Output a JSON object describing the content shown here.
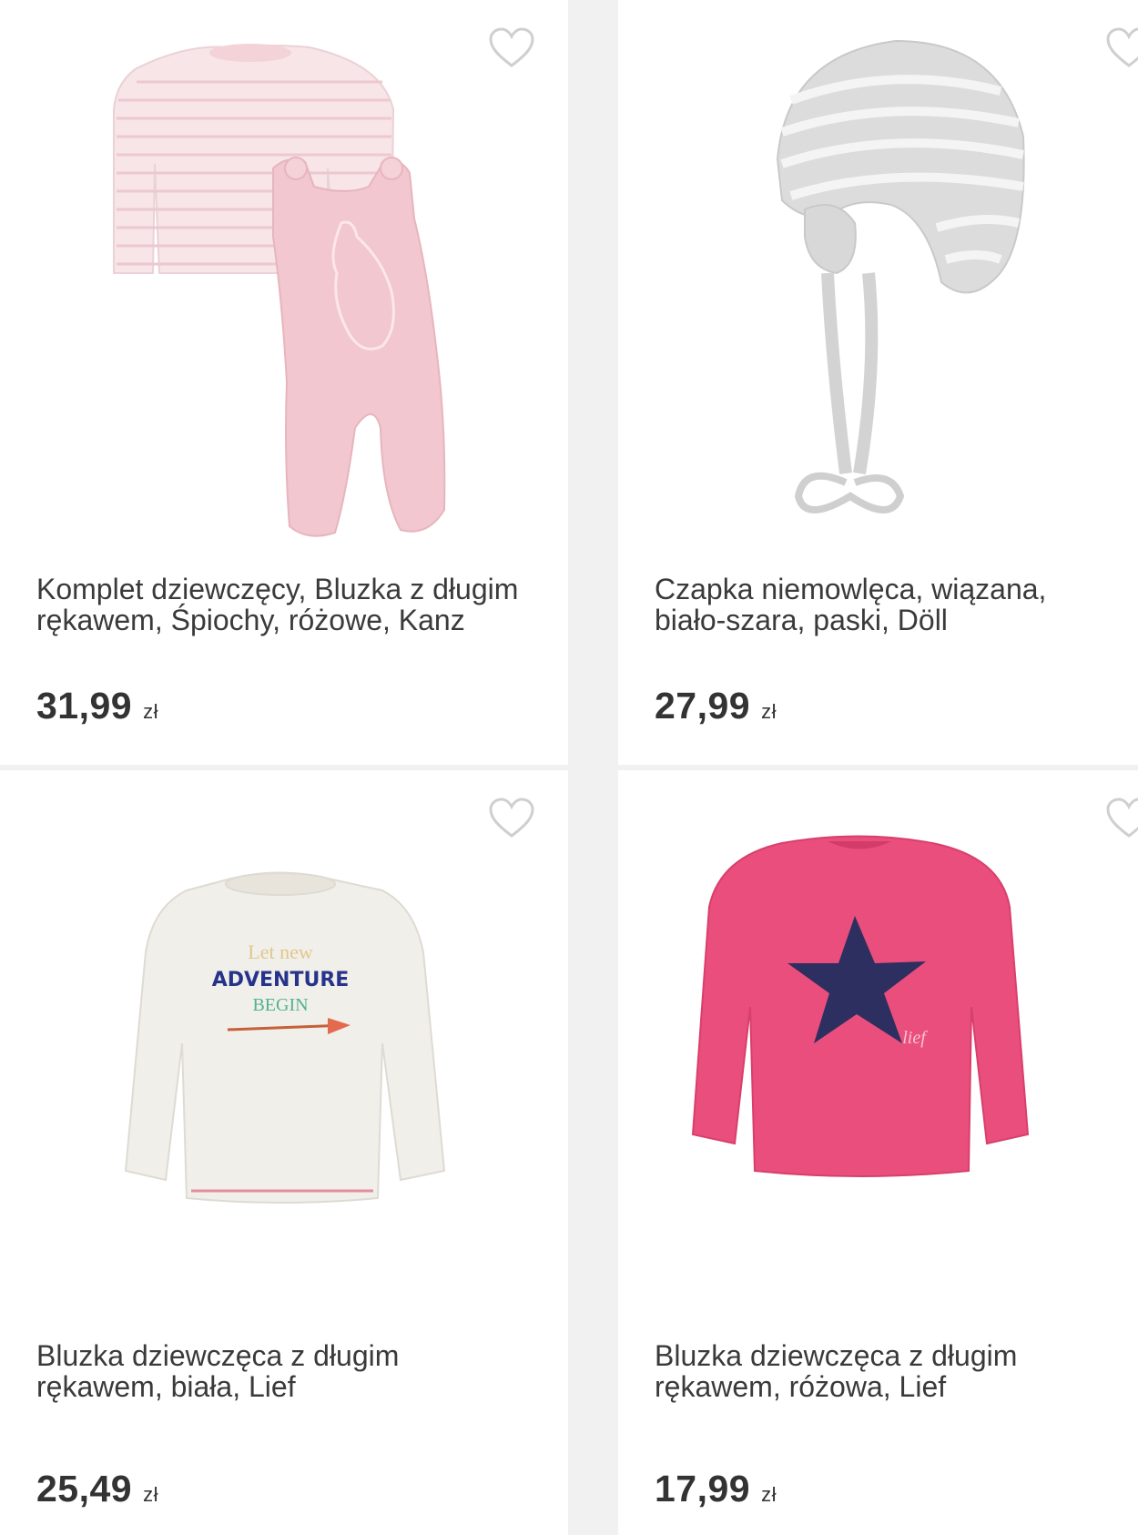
{
  "products": [
    {
      "title": "Komplet dziewczęcy, Bluzka z długim rękawem, Śpiochy, różowe, Kanz",
      "price": "31,99",
      "currency": "zł"
    },
    {
      "title": "Czapka niemowlęca, wiązana, biało-szara, paski, Döll",
      "price": "27,99",
      "currency": "zł"
    },
    {
      "title": "Bluzka dziewczęca z długim rękawem, biała, Lief",
      "price": "25,49",
      "currency": "zł",
      "print_text": [
        "Let new",
        "ADVENTURE",
        "BEGIN"
      ]
    },
    {
      "title": "Bluzka dziewczęca z długim rękawem, różowa, Lief",
      "price": "17,99",
      "currency": "zł",
      "print_text": "lief"
    }
  ],
  "icons": {
    "favorite": "heart-outline-icon"
  },
  "colors": {
    "background": "#f1f1f1",
    "card": "#ffffff",
    "heart": "#cfcfcf",
    "text": "#333333"
  }
}
